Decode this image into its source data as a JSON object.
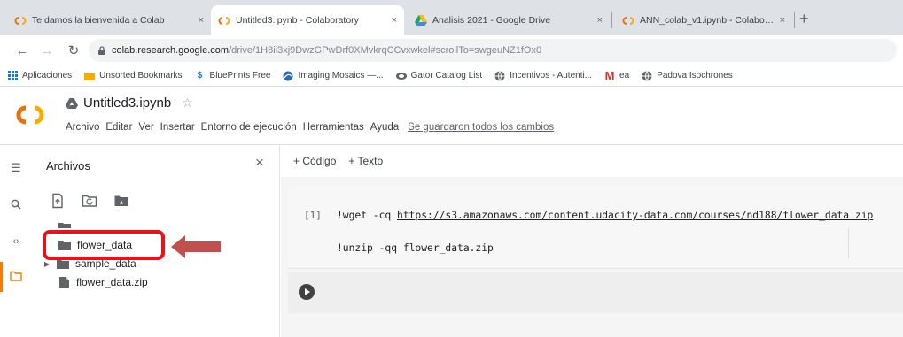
{
  "browser": {
    "tabs": [
      {
        "label": "Te damos la bienvenida a Colab",
        "icon": "colab-icon"
      },
      {
        "label": "Untitled3.ipynb - Colaboratory",
        "icon": "colab-icon"
      },
      {
        "label": "Analisis 2021 - Google Drive",
        "icon": "google-drive-icon"
      },
      {
        "label": "ANN_colab_v1.ipynb - Colaborat",
        "icon": "colab-icon"
      }
    ],
    "new_tab": "+",
    "close_glyph": "×",
    "url_host": "colab.research.google.com",
    "url_path": "/drive/1H8ii3xj9DwzGPwDrf0XMvkrqCCvxwkel#scrollTo=swgeuNZ1fOx0"
  },
  "bookmarks": [
    {
      "label": "Aplicaciones",
      "icon": "apps-grid-icon"
    },
    {
      "label": "Unsorted Bookmarks",
      "icon": "folder-icon"
    },
    {
      "label": "BluePrints Free",
      "icon": "blueprints-icon"
    },
    {
      "label": "Imaging Mosaics —...",
      "icon": "imaging-icon"
    },
    {
      "label": "Gator Catalog List",
      "icon": "gator-icon"
    },
    {
      "label": "Incentivos - Autenti...",
      "icon": "globe-icon"
    },
    {
      "label": "ea",
      "icon": "gmail-icon"
    },
    {
      "label": "Padova Isochrones",
      "icon": "globe-icon"
    }
  ],
  "notebook": {
    "title": "Untitled3.ipynb",
    "menu": [
      "Archivo",
      "Editar",
      "Ver",
      "Insertar",
      "Entorno de ejecución",
      "Herramientas",
      "Ayuda"
    ],
    "save_status": "Se guardaron todos los cambios"
  },
  "files_panel": {
    "title": "Archivos",
    "items": [
      {
        "name": "flower_data",
        "type": "folder",
        "highlighted": true
      },
      {
        "name": "sample_data",
        "type": "folder",
        "expandable": true
      },
      {
        "name": "flower_data.zip",
        "type": "file"
      }
    ]
  },
  "editor": {
    "add_code": "+ Código",
    "add_text": "+ Texto",
    "cell": {
      "exec_count": "[1]",
      "line1_cmd": "!wget -cq ",
      "line1_url": "https://s3.amazonaws.com/content.udacity-data.com/courses/nd188/flower_data.zip",
      "line2": "!unzip -qq flower_data.zip"
    }
  },
  "colors": {
    "highlight": "#e8121b",
    "arrow": "#c0504d",
    "colab_orange": "#f9ab00"
  }
}
